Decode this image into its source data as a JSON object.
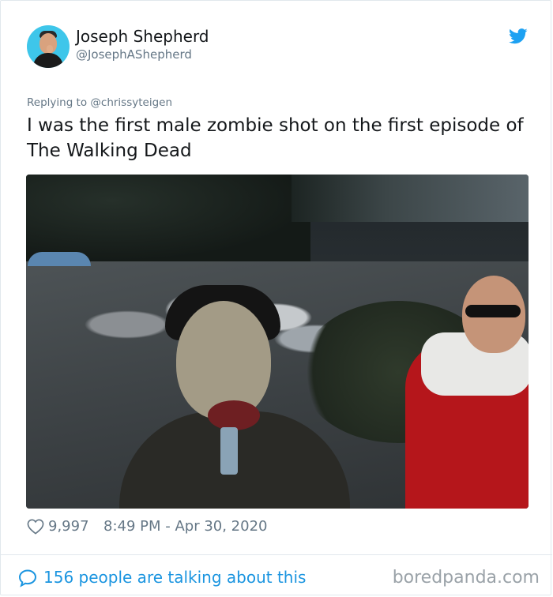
{
  "author": {
    "name": "Joseph Shepherd",
    "handle": "@JosephAShepherd",
    "avatar_icon": "avatar-photo"
  },
  "brand": {
    "icon": "twitter-bird-icon",
    "color": "#1da1f2"
  },
  "reply": {
    "text": "Replying to @chrissyteigen"
  },
  "tweet": {
    "text": "I was the first male zombie shot on the first episode of The Walking Dead"
  },
  "photo": {
    "description_icon": "tweet-photo"
  },
  "meta": {
    "likes": "9,997",
    "timestamp": "8:49 PM - Apr 30, 2020",
    "heart_icon": "heart-outline-icon"
  },
  "footer": {
    "talking": "156 people are talking about this",
    "talk_icon": "speech-bubble-icon",
    "link_color": "#1b95e0"
  },
  "watermark": {
    "text": "boredpanda.com"
  }
}
